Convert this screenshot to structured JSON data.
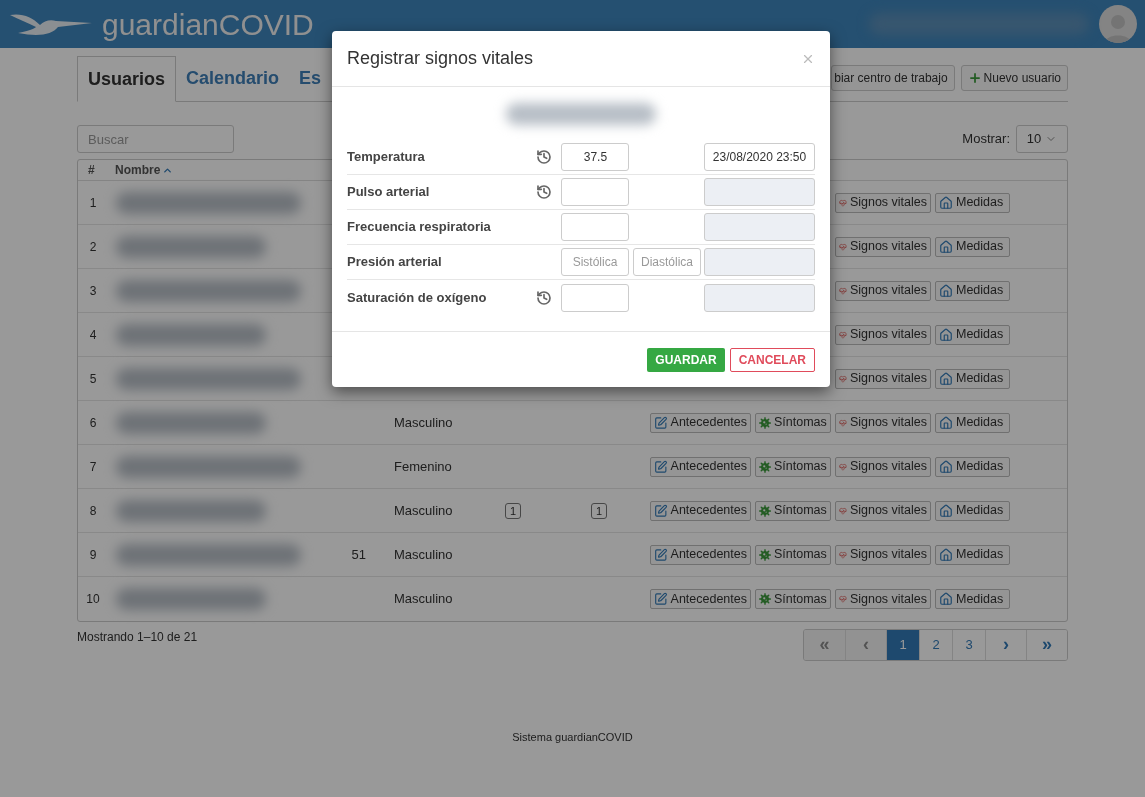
{
  "header": {
    "brand": "guardianCOVID"
  },
  "tabs": [
    {
      "label": "Usuarios",
      "selected": true
    },
    {
      "label": "Calendario",
      "selected": false
    },
    {
      "label": "Es",
      "selected": false
    }
  ],
  "toolbar": {
    "buttons": [
      {
        "label": "biar centro de trabajo",
        "kind": "plain"
      },
      {
        "label": "Nuevo usuario",
        "kind": "add"
      }
    ]
  },
  "search": {
    "placeholder": "Buscar"
  },
  "page_size": {
    "label": "Mostrar:",
    "value": "10"
  },
  "table": {
    "columns": [
      {
        "label": "#",
        "sorted": false
      },
      {
        "label": "Nombre",
        "sorted": true
      }
    ],
    "rows": [
      {
        "number": "1",
        "actions": [
          {
            "kind": "vitals",
            "label": "Signos vitales"
          },
          {
            "kind": "measures",
            "label": "Medidas"
          }
        ]
      },
      {
        "number": "2",
        "actions": [
          {
            "kind": "vitals",
            "label": "Signos vitales"
          },
          {
            "kind": "measures",
            "label": "Medidas"
          }
        ]
      },
      {
        "number": "3",
        "actions": [
          {
            "kind": "vitals",
            "label": "Signos vitales"
          },
          {
            "kind": "measures",
            "label": "Medidas"
          }
        ]
      },
      {
        "number": "4",
        "actions": [
          {
            "kind": "vitals",
            "label": "Signos vitales"
          },
          {
            "kind": "measures",
            "label": "Medidas"
          }
        ]
      },
      {
        "number": "5",
        "actions": [
          {
            "kind": "vitals",
            "label": "Signos vitales"
          },
          {
            "kind": "measures",
            "label": "Medidas"
          }
        ]
      },
      {
        "number": "6",
        "gender": "Masculino",
        "actions": [
          {
            "kind": "history",
            "label": "Antecedentes"
          },
          {
            "kind": "symptoms",
            "label": "Síntomas"
          },
          {
            "kind": "vitals",
            "label": "Signos vitales"
          },
          {
            "kind": "measures",
            "label": "Medidas"
          }
        ]
      },
      {
        "number": "7",
        "gender": "Femenino",
        "actions": [
          {
            "kind": "history",
            "label": "Antecedentes"
          },
          {
            "kind": "symptoms",
            "label": "Síntomas"
          },
          {
            "kind": "vitals",
            "label": "Signos vitales"
          },
          {
            "kind": "measures",
            "label": "Medidas"
          }
        ]
      },
      {
        "number": "8",
        "gender": "Masculino",
        "badge_1": "1",
        "badge_2": "1",
        "actions": [
          {
            "kind": "history",
            "label": "Antecedentes"
          },
          {
            "kind": "symptoms",
            "label": "Síntomas"
          },
          {
            "kind": "vitals",
            "label": "Signos vitales"
          },
          {
            "kind": "measures",
            "label": "Medidas"
          }
        ]
      },
      {
        "number": "9",
        "age": "51",
        "gender": "Masculino",
        "actions": [
          {
            "kind": "history",
            "label": "Antecedentes"
          },
          {
            "kind": "symptoms",
            "label": "Síntomas"
          },
          {
            "kind": "vitals",
            "label": "Signos vitales"
          },
          {
            "kind": "measures",
            "label": "Medidas"
          }
        ]
      },
      {
        "number": "10",
        "gender": "Masculino",
        "actions": [
          {
            "kind": "history",
            "label": "Antecedentes"
          },
          {
            "kind": "symptoms",
            "label": "Síntomas"
          },
          {
            "kind": "vitals",
            "label": "Signos vitales"
          },
          {
            "kind": "measures",
            "label": "Medidas"
          }
        ]
      }
    ]
  },
  "summary": "Mostrando 1–10 de 21",
  "pagination": [
    {
      "label": "«",
      "kind": "first",
      "disabled": true,
      "selected": false
    },
    {
      "label": "‹",
      "kind": "prev",
      "disabled": true,
      "selected": false
    },
    {
      "label": "1",
      "kind": "page",
      "disabled": false,
      "selected": true
    },
    {
      "label": "2",
      "kind": "page",
      "disabled": false,
      "selected": false
    },
    {
      "label": "3",
      "kind": "page",
      "disabled": false,
      "selected": false
    },
    {
      "label": "›",
      "kind": "next",
      "disabled": false,
      "selected": false
    },
    {
      "label": "»",
      "kind": "last",
      "disabled": false,
      "selected": false
    }
  ],
  "footer": "Sistema guardianCOVID",
  "modal": {
    "title": "Registrar signos vitales",
    "fields": [
      {
        "label": "Temperatura",
        "history": true,
        "kind": "single",
        "value": "37.5",
        "timestamp": "23/08/2020 23:50"
      },
      {
        "label": "Pulso arterial",
        "history": true,
        "kind": "single"
      },
      {
        "label": "Frecuencia respiratoria",
        "history": false,
        "kind": "single"
      },
      {
        "label": "Presión arterial",
        "history": false,
        "kind": "pair",
        "placeholders": [
          "Sistólica",
          "Diastólica"
        ]
      },
      {
        "label": "Saturación de oxígeno",
        "history": true,
        "kind": "single"
      }
    ],
    "buttons": [
      {
        "label": "GUARDAR",
        "kind": "primary"
      },
      {
        "label": "CANCELAR",
        "kind": "danger"
      }
    ]
  }
}
